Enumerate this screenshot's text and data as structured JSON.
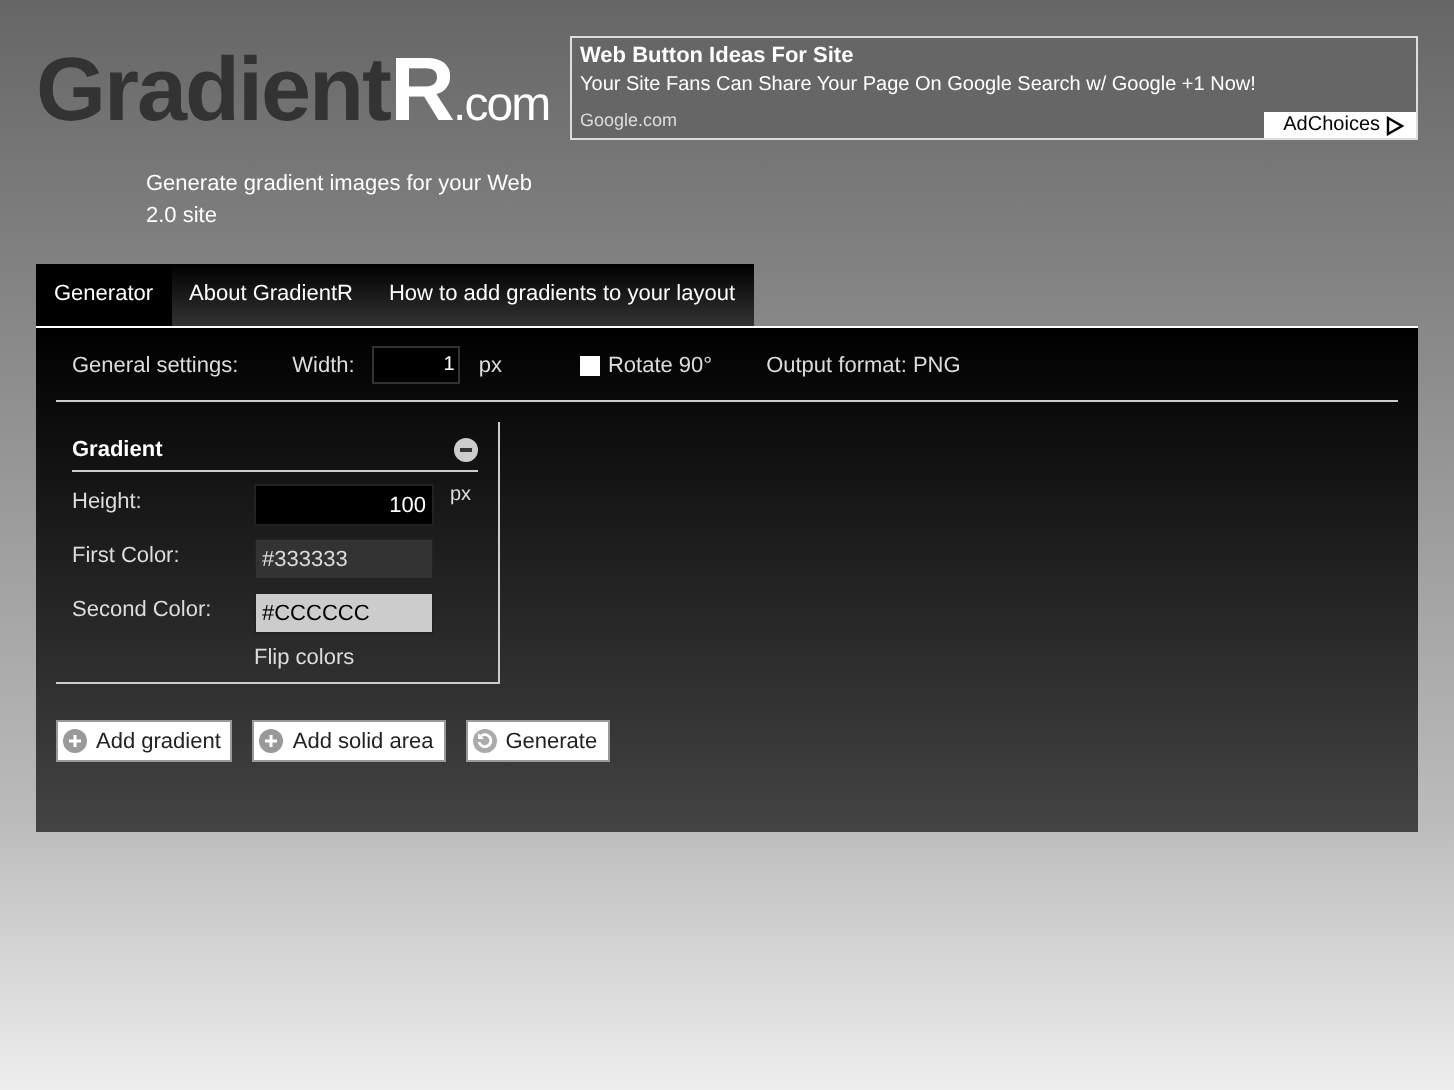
{
  "logo": {
    "dark": "Gradient",
    "light": "R",
    ".com": ".com"
  },
  "tagline": "Generate gradient images for your Web 2.0 site",
  "ad": {
    "title": "Web Button Ideas For Site",
    "text": "Your Site Fans Can Share Your Page On Google Search w/ Google +1 Now!",
    "url": "Google.com",
    "badge": "AdChoices"
  },
  "tabs": [
    {
      "label": "Generator",
      "selected": true
    },
    {
      "label": "About GradientR",
      "selected": false
    },
    {
      "label": "How to add gradients to your layout",
      "selected": false
    }
  ],
  "general": {
    "label": "General settings:",
    "width_label": "Width:",
    "width_value": "1",
    "width_unit": "px",
    "rotate": {
      "label": "Rotate 90°",
      "checked": false
    },
    "output": "Output format: PNG"
  },
  "gradient": {
    "title": "Gradient",
    "fields": [
      {
        "kind": "number",
        "label": "Height:",
        "value": "100",
        "unit": "px"
      },
      {
        "kind": "color",
        "label": "First Color:",
        "value": "#333333"
      },
      {
        "kind": "color",
        "label": "Second Color:",
        "value": "#CCCCCC"
      }
    ],
    "flip": "Flip colors"
  },
  "buttons": [
    {
      "kind": "add",
      "label": "Add gradient"
    },
    {
      "kind": "add",
      "label": "Add solid area"
    },
    {
      "kind": "refresh",
      "label": "Generate"
    }
  ]
}
